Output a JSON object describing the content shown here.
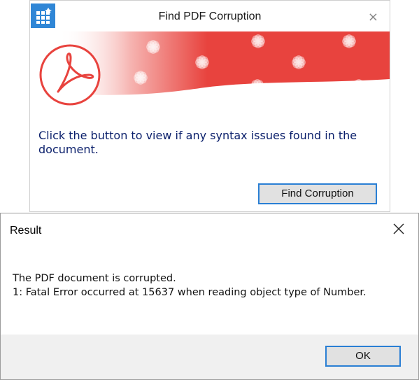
{
  "main_window": {
    "title": "Find PDF Corruption",
    "close_glyph": "×",
    "app_icon": "grid-app-icon",
    "banner_logo": "adobe-acrobat-icon",
    "message": "Click the button to view if any syntax issues found in the document.",
    "button_label": "Find Corruption"
  },
  "result_dialog": {
    "title": "Result",
    "line1": "The PDF document is corrupted.",
    "line2": "1: Fatal Error occurred at 15637 when reading object type of Number.",
    "ok_label": "OK"
  },
  "colors": {
    "accent_blue": "#2a7fd4",
    "banner_red": "#e8433e",
    "message_text": "#0a1f6b",
    "footer_gray": "#f0f0f0"
  }
}
